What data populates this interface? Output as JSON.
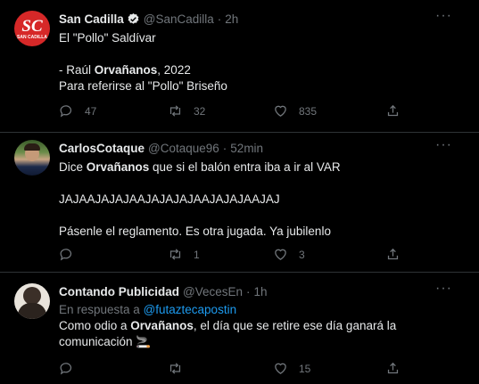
{
  "tweets": [
    {
      "name": "San Cadilla",
      "handle": "@SanCadilla",
      "dot": "·",
      "time": "2h",
      "verified": true,
      "avatar_text": "SC",
      "avatar_sub": "SAN CADILLA",
      "lines": [
        "El \"Pollo\" Saldívar",
        "",
        "- Raúl Orvañanos, 2022",
        "Para referirse al \"Pollo\" Briseño"
      ],
      "replies": "47",
      "retweets": "32",
      "likes": "835"
    },
    {
      "name": "CarlosCotaque",
      "handle": "@Cotaque96",
      "dot": "·",
      "time": "52min",
      "lines_pre": "Dice ",
      "bold_word": "Orvañanos",
      "lines_post": " que si el balón entra iba a ir al VAR",
      "line2": "JAJAAJAJAJAAJAJAJAJAAJAJAJAAJAJ",
      "line3": "Pásenle el reglamento. Es otra jugada. Ya jubilenlo",
      "replies": "",
      "retweets": "1",
      "likes": "3"
    },
    {
      "name": "Contando Publicidad",
      "handle": "@VecesEn",
      "dot": "·",
      "time": "1h",
      "reply_prefix": "En respuesta a ",
      "reply_handle": "@futaztecapostin",
      "line1_pre": "Como odio a ",
      "bold_word": "Orvañanos",
      "line1_post": ", el día que se retire ese día ganará la",
      "line2": "comunicación 🚬",
      "replies": "",
      "retweets": "",
      "likes": "15"
    }
  ],
  "more_label": "···",
  "colors": {
    "bg": "#000000",
    "text": "#e7e9ea",
    "muted": "#71767b",
    "link": "#1d9bf0",
    "divider": "#2f3336",
    "sc_red": "#d62828"
  }
}
